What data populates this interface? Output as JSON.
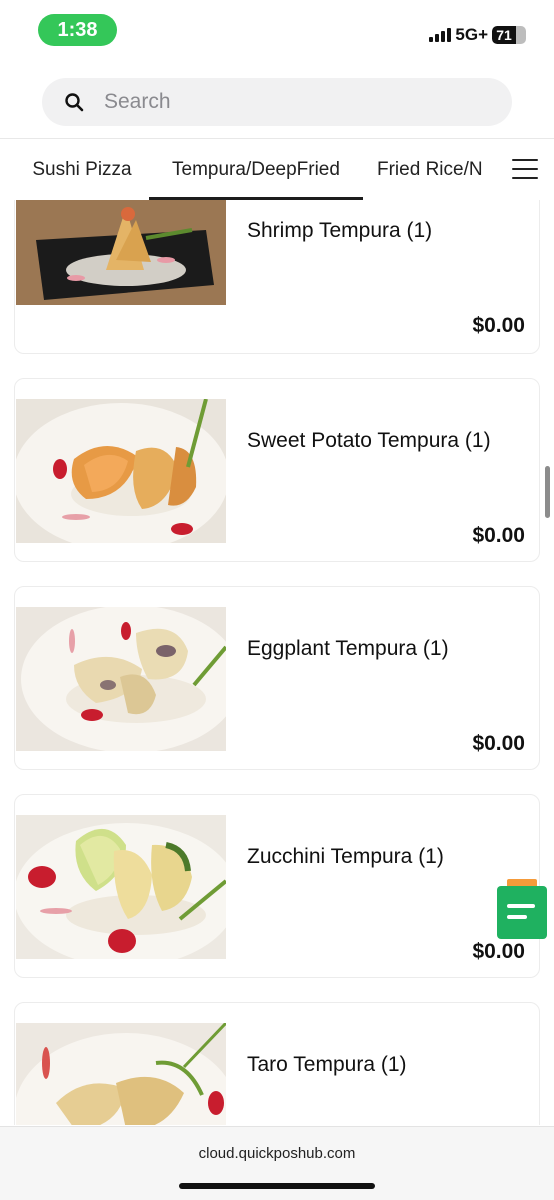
{
  "status_bar": {
    "time": "1:38",
    "network": "5G+",
    "battery": "71",
    "battery_level": 0.71
  },
  "search": {
    "placeholder": "Search",
    "value": ""
  },
  "tabs": [
    {
      "label": "Sushi Pizza",
      "active": false
    },
    {
      "label": "Tempura/DeepFried",
      "active": true
    },
    {
      "label": "Fried Rice/N",
      "active": false
    }
  ],
  "items": [
    {
      "name": "Shrimp Tempura (1)",
      "price": "$0.00",
      "image": "shrimp-tempura-photo"
    },
    {
      "name": "Sweet Potato Tempura (1)",
      "price": "$0.00",
      "image": "sweet-potato-tempura-photo"
    },
    {
      "name": "Eggplant Tempura (1)",
      "price": "$0.00",
      "image": "eggplant-tempura-photo"
    },
    {
      "name": "Zucchini Tempura (1)",
      "price": "$0.00",
      "image": "zucchini-tempura-photo"
    },
    {
      "name": "Taro Tempura (1)",
      "price": "$0.00",
      "image": "taro-tempura-photo"
    }
  ],
  "icons": {
    "search": "search-icon",
    "menu": "hamburger-menu-icon",
    "order": "order-list-icon"
  },
  "colors": {
    "time_pill": "#34c759",
    "order_button": "#1fb160",
    "order_button_tab": "#f59b3a",
    "active_tab_underline": "#1d1d1d"
  },
  "browser": {
    "url": "cloud.quickposhub.com"
  }
}
